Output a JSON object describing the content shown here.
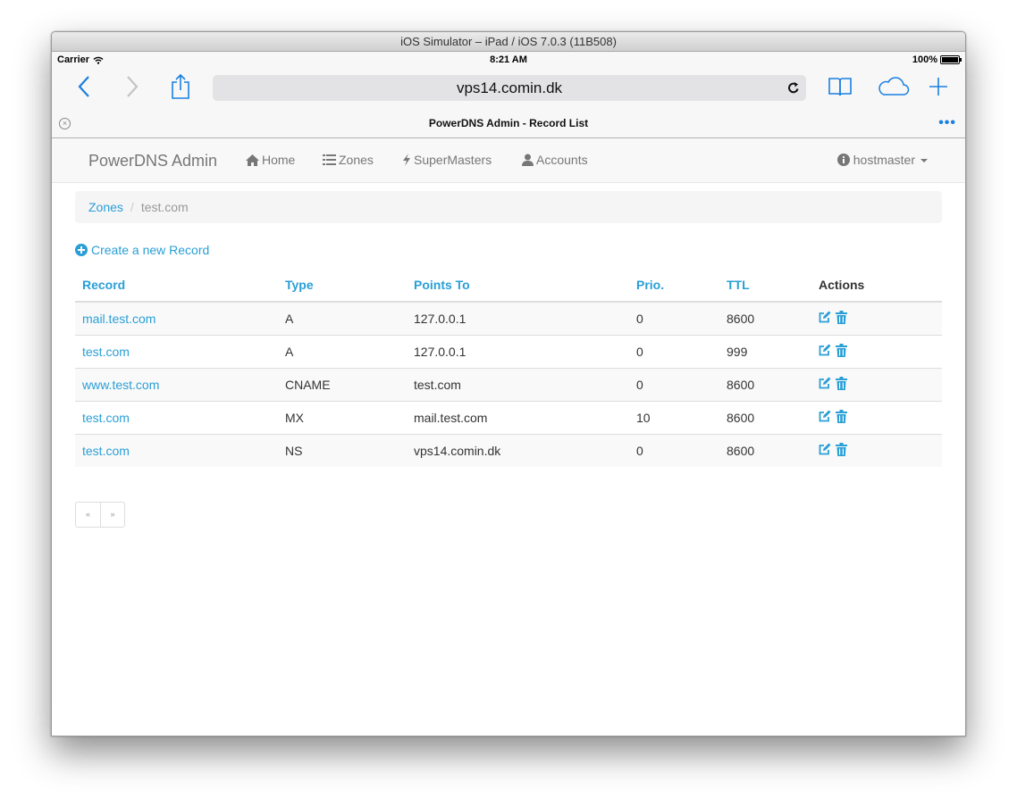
{
  "simulator": {
    "title": "iOS Simulator – iPad / iOS 7.0.3 (11B508)"
  },
  "status_bar": {
    "carrier": "Carrier",
    "time": "8:21 AM",
    "battery": "100%"
  },
  "browser": {
    "url": "vps14.comin.dk",
    "tab_title": "PowerDNS Admin - Record List"
  },
  "navbar": {
    "brand": "PowerDNS Admin",
    "items": [
      {
        "label": "Home",
        "icon": "home-icon"
      },
      {
        "label": "Zones",
        "icon": "list-icon"
      },
      {
        "label": "SuperMasters",
        "icon": "bolt-icon"
      },
      {
        "label": "Accounts",
        "icon": "user-icon"
      }
    ],
    "user": "hostmaster"
  },
  "breadcrumb": {
    "root": "Zones",
    "current": "test.com"
  },
  "create_link": "Create a new Record",
  "table": {
    "headers": [
      "Record",
      "Type",
      "Points To",
      "Prio.",
      "TTL",
      "Actions"
    ],
    "rows": [
      {
        "record": "mail.test.com",
        "type": "A",
        "points_to": "127.0.0.1",
        "prio": "0",
        "ttl": "8600"
      },
      {
        "record": "test.com",
        "type": "A",
        "points_to": "127.0.0.1",
        "prio": "0",
        "ttl": "999"
      },
      {
        "record": "www.test.com",
        "type": "CNAME",
        "points_to": "test.com",
        "prio": "0",
        "ttl": "8600"
      },
      {
        "record": "test.com",
        "type": "MX",
        "points_to": "mail.test.com",
        "prio": "10",
        "ttl": "8600"
      },
      {
        "record": "test.com",
        "type": "NS",
        "points_to": "vps14.comin.dk",
        "prio": "0",
        "ttl": "8600"
      }
    ]
  },
  "pagination": {
    "prev": "«",
    "next": "»"
  },
  "colors": {
    "accent": "#2a9fd6",
    "ios_blue": "#1a7fe0"
  }
}
